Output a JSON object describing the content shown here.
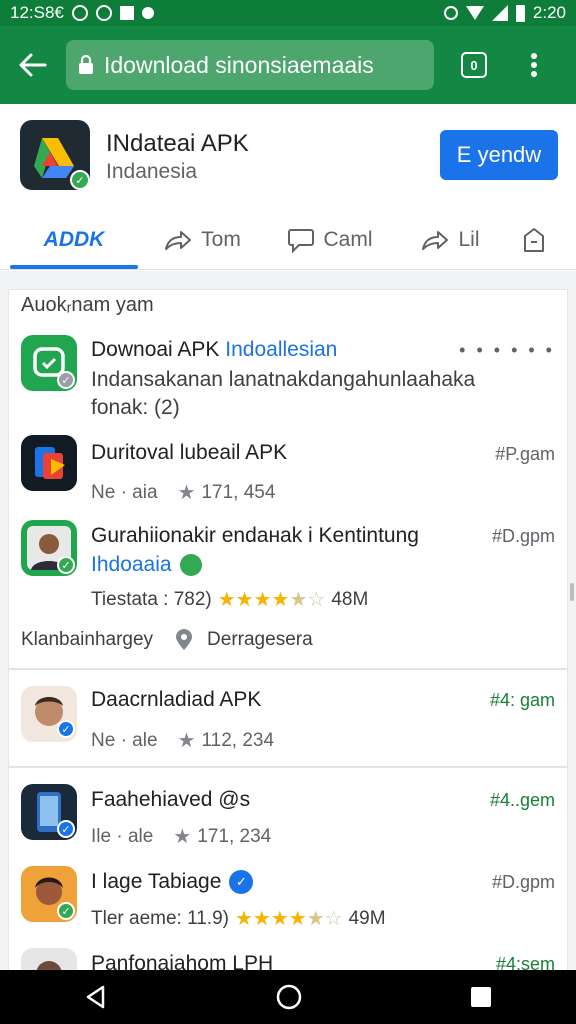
{
  "status_bar": {
    "time_left": "12:S8€",
    "time_right": "2:20"
  },
  "toolbar": {
    "url": "Idownload sinonsiaemaais",
    "tab_count": "0"
  },
  "app": {
    "title": "INdateai APK",
    "subtitle": "Indanesia",
    "install_label": "E yendw"
  },
  "tabs": [
    {
      "label": "ADDK"
    },
    {
      "label": "Tom"
    },
    {
      "label": "Caml"
    },
    {
      "label": "Lil"
    }
  ],
  "list": {
    "section_label": "Auokᵣnam   yam",
    "items": [
      {
        "title": "Downoai APK",
        "title_highlight": "Indoallesian",
        "description": "Indansakanan lanatnakdangahunlaahaka",
        "description2": "fonak: (2)",
        "more": "• • • • • •"
      },
      {
        "title": "Duritoval lubeail APK",
        "meta_left": "Ne · aia",
        "rating": "171, 454",
        "right": "#P.gam"
      },
      {
        "title": "Gurahiionakir endaнak i Kentintung",
        "subtitle": "Ihdoaaia",
        "meta_left": "Tiestata : 782)",
        "size": "48M",
        "right": "#D.gpm"
      }
    ],
    "footer_left": "Klanbainhargey",
    "footer_right": "Derragesera",
    "items2": [
      {
        "title": "Daacrnladiad APK",
        "meta_left": "Ne · ale",
        "rating": "112, 234",
        "right": "#4: gam"
      },
      {
        "title": "Faahehiaved @s",
        "meta_left": "Ile · ale",
        "rating": "171, 234",
        "right": "#4..gem"
      },
      {
        "title": "I lage Tabiage",
        "meta_left": "Tler aeme: 11.9)",
        "size": "49M",
        "right": "#D.gpm"
      },
      {
        "title": "Panfonaiahom LPH",
        "right": "#4:sem"
      }
    ]
  },
  "colors": {
    "status_bar": "#0f7d3a",
    "toolbar": "#138744",
    "accent": "#1a73e8",
    "verified": "#34a853",
    "star": "#f4b400"
  }
}
